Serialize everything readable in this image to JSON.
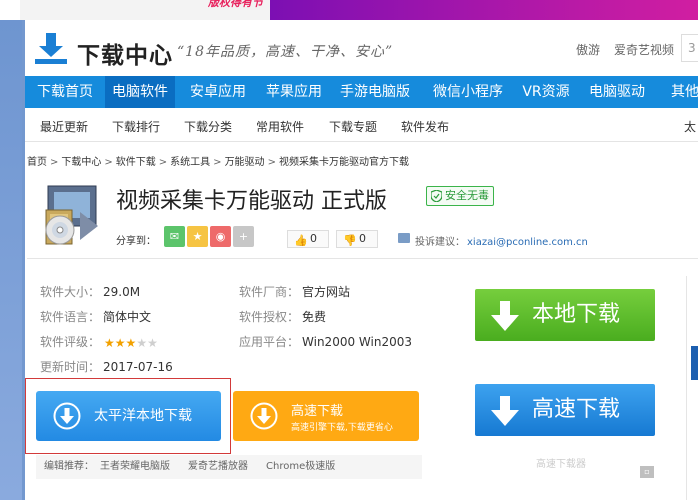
{
  "top_banner": {
    "promo_text": "版权得有节"
  },
  "header": {
    "logo_text": "下载中心",
    "slogan": "“18年品质，高速、干净、安心”",
    "links": [
      "傲游",
      "爱奇艺视频"
    ],
    "search_stub": "3"
  },
  "nav": {
    "items": [
      "下载首页",
      "电脑软件",
      "安卓应用",
      "苹果应用",
      "手游电脑版",
      "微信小程序",
      "VR资源",
      "电脑驱动",
      "其他"
    ],
    "active_index": 1,
    "color": "#168bdc",
    "active_color": "#0a6dc1"
  },
  "subnav": {
    "items": [
      "最近更新",
      "下载排行",
      "下载分类",
      "常用软件",
      "下载专题",
      "软件发布"
    ],
    "right_text": "太"
  },
  "breadcrumb": [
    "首页",
    "下载中心",
    "软件下载",
    "系统工具",
    "万能驱动",
    "视频采集卡万能驱动官方下载"
  ],
  "software": {
    "title": "视频采集卡万能驱动 正式版",
    "safe_badge": "安全无毒",
    "share_label": "分享到：",
    "share_icons": [
      "wechat-icon",
      "qzone-icon",
      "weibo-icon",
      "more-share-icon"
    ],
    "like_count": "0",
    "dislike_count": "0",
    "feedback_label": "投诉建议：",
    "feedback_email": "xiazai@pconline.com.cn"
  },
  "info": {
    "size_label": "软件大小：",
    "size": "29.0M",
    "vendor_label": "软件厂商：",
    "vendor": "官方网站",
    "lang_label": "软件语言：",
    "lang": "简体中文",
    "license_label": "软件授权：",
    "license": "免费",
    "rating_label": "软件评级：",
    "rating": 3,
    "rating_max": 5,
    "platform_label": "应用平台：",
    "platform": "Win2000 Win2003",
    "updated_label": "更新时间：",
    "updated": "2017-07-16"
  },
  "downloads": {
    "local_big": "本地下载",
    "fast_big": "高速下载",
    "fast_big_hint": "高速下载器",
    "pconline": "太平洋本地下载",
    "fast_small_title": "高速下载",
    "fast_small_sub": "高速引擎下载,下载更省心"
  },
  "recommend": {
    "label": "编辑推荐：",
    "items": [
      "王者荣耀电脑版",
      "爱奇艺播放器",
      "Chrome极速版"
    ]
  }
}
